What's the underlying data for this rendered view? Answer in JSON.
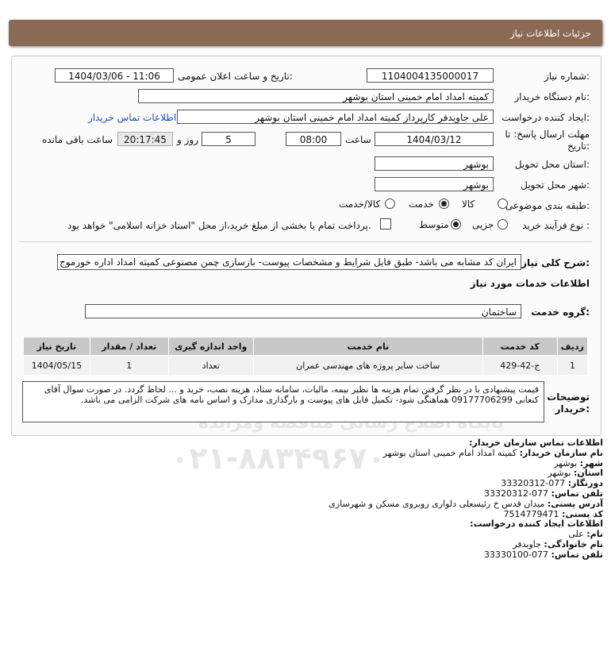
{
  "header": {
    "title": "جزئیات اطلاعات نیاز"
  },
  "watermark": {
    "line1": "ParsNamadData",
    "line2": "پایگاه اطلاع رسانی مناقصه ومزایده",
    "line3": "۰۲۱-۸۸۳۴۹۶۷۰"
  },
  "form": {
    "need_number_label": "شماره نیاز:",
    "need_number": "1104004135000017",
    "announce_label": "تاریخ و ساعت اعلان عمومی:",
    "announce_value": "1404/03/06 - 11:06",
    "buyer_org_label": "نام دستگاه خریدار:",
    "buyer_org": "کمیته امداد امام خمینی استان بوشهر",
    "creator_label": "ایجاد کننده درخواست:",
    "creator": "علی جاویدفر کارپرداز کمیته امداد امام خمینی استان بوشهر",
    "buyer_contact_link": "اطلاعات تماس خریدار",
    "deadline_label_1": "مهلت ارسال پاسخ: تا",
    "deadline_label_2": "تاریخ:",
    "deadline_date": "1404/03/12",
    "hour_label": "ساعت",
    "deadline_time": "08:00",
    "days_value": "5",
    "days_label": "روز و",
    "remaining_time": "20:17:45",
    "remaining_label": "ساعت باقی مانده",
    "province_label": "استان محل تحویل:",
    "province": "بوشهر",
    "city_label": "شهر محل تحویل:",
    "city": "بوشهر",
    "category_label": "طبقه بندی موضوعی:",
    "category_options": [
      "کالا",
      "خدمت",
      "کالا/خدمت"
    ],
    "category_selected": "خدمت",
    "process_label": "نوع فرآیند خرید :",
    "process_options": [
      "جزیی",
      "متوسط"
    ],
    "process_selected": "متوسط",
    "treasury_note": "پرداخت تمام یا بخشی از مبلغ خرید،از محل \"اسناد خزانه اسلامی\" خواهد بود.",
    "need_desc_label": "شرح کلی نیاز:",
    "need_desc": "ایران کد مشابه می باشد- طبق فایل شرایط و مشخصات پیوست- بازسازی چمن مصنوعی کمیته امداد اداره خورموج",
    "services_title": "اطلاعات خدمات مورد نیاز",
    "service_group_label": "گروه خدمت:",
    "service_group": "ساختمان"
  },
  "table": {
    "headers": [
      "ردیف",
      "کد خدمت",
      "نام خدمت",
      "واحد اندازه گیری",
      "تعداد / مقدار",
      "تاریخ نیاز"
    ],
    "rows": [
      [
        "1",
        "ج-42-429",
        "ساخت سایر پروژه های مهندسی عمران",
        "تعداد",
        "1",
        "1404/05/15"
      ]
    ]
  },
  "buyer_notes": {
    "label_1": "توضیحات",
    "label_2": "خریدار:",
    "text": "قیمت پیشنهادی با در نظر گرفتن تمام هزینه ها نظیر بیمه، مالیات، سامانه ستاد، هزینه نصب، خرید و ... لحاظ گردد. در صورت سوال آقای کنعانی 09177706299 هماهنگی شود- تکمیل فایل های پیوست و بارگذاری مدارک و اساس نامه های شرکت الزامی می باشد."
  },
  "contact": {
    "title": "اطلاعات تماس سازمان خریدار:",
    "org_label": "نام سازمان خریدار:",
    "org": "کمیته امداد امام خمینی استان بوشهر",
    "city_label": "شهر:",
    "city": "بوشهر",
    "province_label": "استان:",
    "province": "بوشهر",
    "fax_label": "دورنگار:",
    "fax": "077-33320312",
    "phone_label": "تلفن تماس:",
    "phone": "077-33320312",
    "address_label": "آدرس پستی:",
    "address": "میدان قدس خ رئیسعلی دلواری روبروی مسکن و شهرسازی",
    "postal_label": "کد پستی:",
    "postal": "7514779471",
    "creator_title": "اطلاعات ایجاد کننده درخواست:",
    "name_label": "نام:",
    "name": "علی",
    "family_label": "نام خانوادگی:",
    "family": "جاویدفر",
    "creator_phone_label": "تلفن تماس:",
    "creator_phone": "077-33330100"
  }
}
